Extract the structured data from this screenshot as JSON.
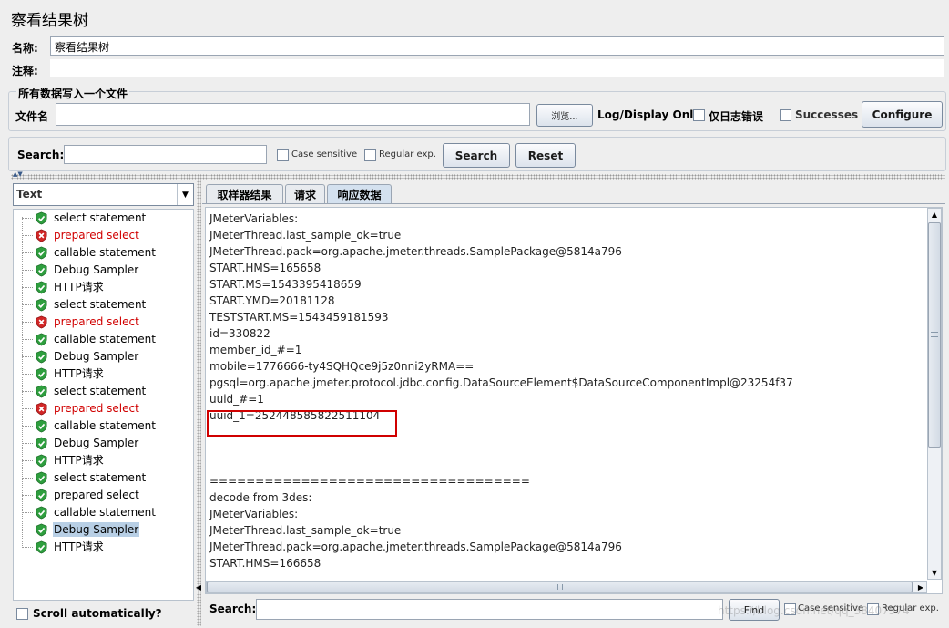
{
  "header": {
    "title": "察看结果树",
    "name_label": "名称:",
    "name_value": "察看结果树",
    "comment_label": "注释:",
    "comment_value": ""
  },
  "file_group": {
    "legend": "所有数据写入一个文件",
    "filename_label": "文件名",
    "filename_value": "",
    "browse_label": "浏览...",
    "log_display_label": "Log/Display Only:",
    "errors_only_label": "仅日志错误",
    "successes_label": "Successes",
    "configure_label": "Configure"
  },
  "search": {
    "label": "Search:",
    "value": "",
    "case_sensitive_label": "Case sensitive",
    "regex_label": "Regular exp.",
    "search_button": "Search",
    "reset_button": "Reset"
  },
  "renderer": {
    "selected": "Text"
  },
  "tree": [
    {
      "label": "select statement",
      "status": "success"
    },
    {
      "label": "prepared select",
      "status": "error"
    },
    {
      "label": "callable statement",
      "status": "success"
    },
    {
      "label": "Debug Sampler",
      "status": "success"
    },
    {
      "label": "HTTP请求",
      "status": "success"
    },
    {
      "label": "select statement",
      "status": "success"
    },
    {
      "label": "prepared select",
      "status": "error"
    },
    {
      "label": "callable statement",
      "status": "success"
    },
    {
      "label": "Debug Sampler",
      "status": "success"
    },
    {
      "label": "HTTP请求",
      "status": "success"
    },
    {
      "label": "select statement",
      "status": "success"
    },
    {
      "label": "prepared select",
      "status": "error"
    },
    {
      "label": "callable statement",
      "status": "success"
    },
    {
      "label": "Debug Sampler",
      "status": "success"
    },
    {
      "label": "HTTP请求",
      "status": "success"
    },
    {
      "label": "select statement",
      "status": "success"
    },
    {
      "label": "prepared select",
      "status": "success"
    },
    {
      "label": "callable statement",
      "status": "success"
    },
    {
      "label": "Debug Sampler",
      "status": "success",
      "selected": true
    },
    {
      "label": "HTTP请求",
      "status": "success"
    }
  ],
  "scroll_auto_label": "Scroll automatically?",
  "tabs": [
    "取样器结果",
    "请求",
    "响应数据"
  ],
  "active_tab": "响应数据",
  "response_lines": [
    "JMeterVariables:",
    "JMeterThread.last_sample_ok=true",
    "JMeterThread.pack=org.apache.jmeter.threads.SamplePackage@5814a796",
    "START.HMS=165658",
    "START.MS=1543395418659",
    "START.YMD=20181128",
    "TESTSTART.MS=1543459181593",
    "id=330822",
    "member_id_#=1",
    "mobile=1776666-ty4SQHQce9j5z0nni2yRMA==",
    "pgsql=org.apache.jmeter.protocol.jdbc.config.DataSourceElement$DataSourceComponentImpl@23254f37",
    "uuid_#=1",
    "uuid_1=252448585822511104",
    "",
    "",
    "",
    "===================================",
    "decode from 3des:",
    "JMeterVariables:",
    "JMeterThread.last_sample_ok=true",
    "JMeterThread.pack=org.apache.jmeter.threads.SamplePackage@5814a796",
    "START.HMS=166658"
  ],
  "highlight_color": "#d00000",
  "bottom_search": {
    "label": "Search:",
    "value": "",
    "find_label": "Find",
    "case_sensitive_label": "Case sensitive",
    "regex_label": "Regular exp."
  },
  "watermark": "https://blog.csdn.net/qq_38407574"
}
